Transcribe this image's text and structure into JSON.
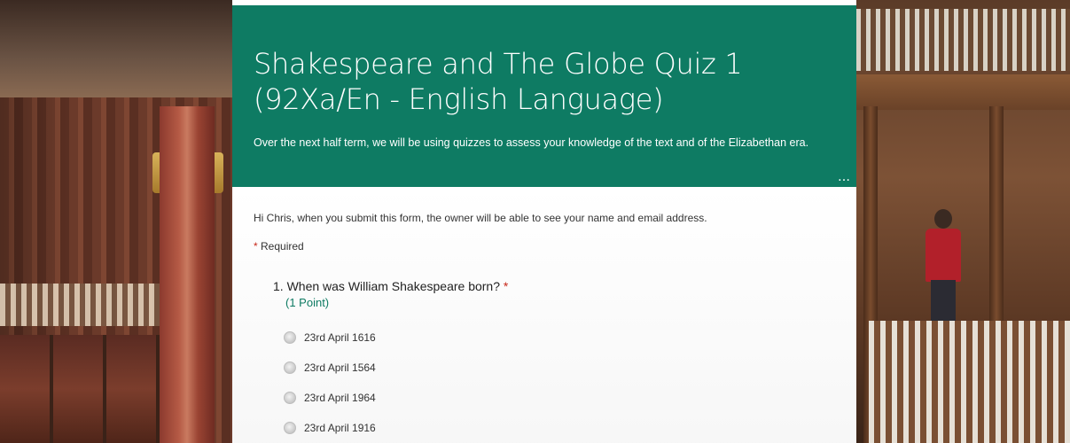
{
  "form": {
    "title": "Shakespeare and The Globe Quiz 1 (92Xa/En - English Language)",
    "description": "Over the next half term, we will be using quizzes to assess your knowledge of the text and of the Elizabethan era.",
    "more_icon": "more-horizontal-icon",
    "more_glyph": "…",
    "notice": "Hi Chris, when you submit this form, the owner will be able to see your name and email address.",
    "required_star": "*",
    "required_label": "Required"
  },
  "question1": {
    "title": "1. When was William Shakespeare born?",
    "required_star": "*",
    "points": "(1 Point)",
    "options": [
      {
        "label": "23rd April 1616"
      },
      {
        "label": "23rd April 1564"
      },
      {
        "label": "23rd April 1964"
      },
      {
        "label": "23rd April 1916"
      }
    ]
  },
  "colors": {
    "header_bg": "#0e7b63",
    "accent": "#0e7b63",
    "required": "#c7281a"
  }
}
